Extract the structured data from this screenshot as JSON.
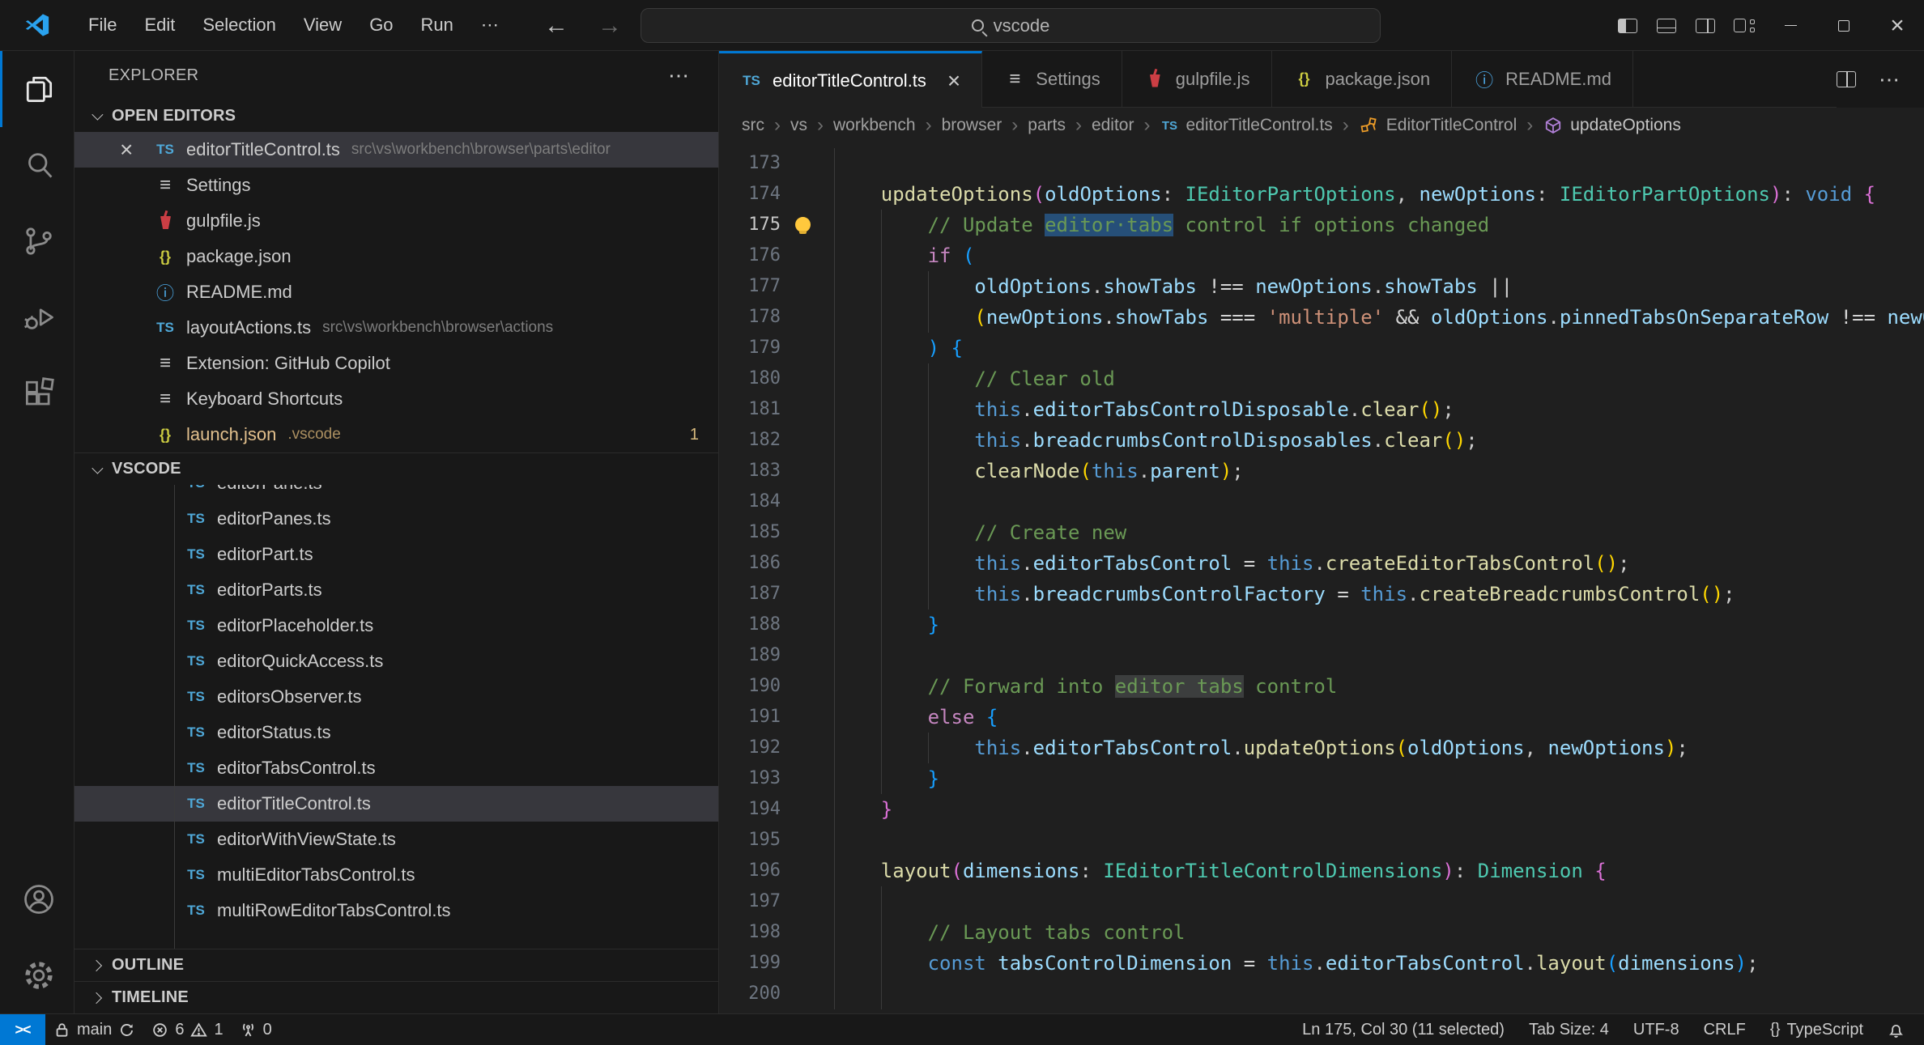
{
  "titlebar": {
    "menus": [
      "File",
      "Edit",
      "Selection",
      "View",
      "Go",
      "Run"
    ],
    "more_label": "⋯",
    "back_arrow": "←",
    "forward_arrow": "→",
    "search": {
      "value": "vscode"
    }
  },
  "activity_bar": {
    "items": [
      {
        "name": "explorer",
        "active": true
      },
      {
        "name": "search",
        "active": false
      },
      {
        "name": "source-control",
        "active": false
      },
      {
        "name": "run-debug",
        "active": false
      },
      {
        "name": "extensions",
        "active": false
      }
    ],
    "bottom": [
      {
        "name": "accounts"
      },
      {
        "name": "settings-gear"
      }
    ]
  },
  "sidebar": {
    "title": "EXPLORER",
    "title_more": "⋯",
    "open_editors": {
      "label": "OPEN EDITORS",
      "items": [
        {
          "icon": "ts",
          "name": "editorTitleControl.ts",
          "path": "src\\vs\\workbench\\browser\\parts\\editor",
          "selected": true
        },
        {
          "icon": "list",
          "name": "Settings"
        },
        {
          "icon": "gulp",
          "name": "gulpfile.js"
        },
        {
          "icon": "json",
          "name": "package.json"
        },
        {
          "icon": "info",
          "name": "README.md"
        },
        {
          "icon": "ts",
          "name": "layoutActions.ts",
          "path": "src\\vs\\workbench\\browser\\actions"
        },
        {
          "icon": "list",
          "name": "Extension: GitHub Copilot"
        },
        {
          "icon": "list",
          "name": "Keyboard Shortcuts"
        },
        {
          "icon": "json",
          "name": "launch.json",
          "path": ".vscode",
          "modified": true,
          "badge": "1"
        }
      ]
    },
    "project": {
      "label": "VSCODE",
      "partial_item": {
        "icon": "ts",
        "name": "editorPane.ts"
      },
      "items": [
        {
          "icon": "ts",
          "name": "editorPanes.ts"
        },
        {
          "icon": "ts",
          "name": "editorPart.ts"
        },
        {
          "icon": "ts",
          "name": "editorParts.ts"
        },
        {
          "icon": "ts",
          "name": "editorPlaceholder.ts"
        },
        {
          "icon": "ts",
          "name": "editorQuickAccess.ts"
        },
        {
          "icon": "ts",
          "name": "editorsObserver.ts"
        },
        {
          "icon": "ts",
          "name": "editorStatus.ts"
        },
        {
          "icon": "ts",
          "name": "editorTabsControl.ts"
        },
        {
          "icon": "ts",
          "name": "editorTitleControl.ts",
          "selected": true
        },
        {
          "icon": "ts",
          "name": "editorWithViewState.ts"
        },
        {
          "icon": "ts",
          "name": "multiEditorTabsControl.ts"
        },
        {
          "icon": "ts",
          "name": "multiRowEditorTabsControl.ts"
        }
      ]
    },
    "sections": [
      {
        "label": "OUTLINE"
      },
      {
        "label": "TIMELINE"
      }
    ]
  },
  "tabs": {
    "items": [
      {
        "icon": "ts",
        "label": "editorTitleControl.ts",
        "active": true,
        "close": "×"
      },
      {
        "icon": "list",
        "label": "Settings"
      },
      {
        "icon": "gulp",
        "label": "gulpfile.js"
      },
      {
        "icon": "json",
        "label": "package.json"
      },
      {
        "icon": "info",
        "label": "README.md"
      }
    ],
    "actions_more": "⋯"
  },
  "breadcrumbs": [
    {
      "label": "src"
    },
    {
      "label": "vs"
    },
    {
      "label": "workbench"
    },
    {
      "label": "browser"
    },
    {
      "label": "parts"
    },
    {
      "label": "editor"
    },
    {
      "label": "editorTitleControl.ts",
      "icon": "ts"
    },
    {
      "label": "EditorTitleControl",
      "icon": "class"
    },
    {
      "label": "updateOptions",
      "icon": "method"
    }
  ],
  "breadcrumb_sep": "›",
  "icons": {
    "ts": "TS",
    "json": "{}",
    "info": "ⓘ",
    "list": "≡",
    "close": "×"
  },
  "code": {
    "bulb_line": 175,
    "lines": [
      {
        "n": 173,
        "i": 1,
        "t": []
      },
      {
        "n": 174,
        "i": 1,
        "t": [
          [
            "fn",
            "updateOptions"
          ],
          [
            "b2",
            "("
          ],
          [
            "var",
            "oldOptions"
          ],
          [
            "txt",
            ": "
          ],
          [
            "type",
            "IEditorPartOptions"
          ],
          [
            "txt",
            ", "
          ],
          [
            "var",
            "newOptions"
          ],
          [
            "txt",
            ": "
          ],
          [
            "type",
            "IEditorPartOptions"
          ],
          [
            "b2",
            ")"
          ],
          [
            "txt",
            ": "
          ],
          [
            "kw",
            "void"
          ],
          [
            "txt",
            " "
          ],
          [
            "b2",
            "{"
          ]
        ]
      },
      {
        "n": 175,
        "i": 2,
        "t": [
          [
            "com",
            "// Update "
          ],
          [
            "com sel",
            "editor·tabs"
          ],
          [
            "com",
            " control if options changed"
          ]
        ]
      },
      {
        "n": 176,
        "i": 2,
        "t": [
          [
            "ctl",
            "if"
          ],
          [
            "txt",
            " "
          ],
          [
            "b3",
            "("
          ]
        ]
      },
      {
        "n": 177,
        "i": 3,
        "t": [
          [
            "var",
            "oldOptions"
          ],
          [
            "txt",
            "."
          ],
          [
            "var",
            "showTabs"
          ],
          [
            "op",
            " !== "
          ],
          [
            "var",
            "newOptions"
          ],
          [
            "txt",
            "."
          ],
          [
            "var",
            "showTabs"
          ],
          [
            "op",
            " ||"
          ]
        ]
      },
      {
        "n": 178,
        "i": 3,
        "t": [
          [
            "b1",
            "("
          ],
          [
            "var",
            "newOptions"
          ],
          [
            "txt",
            "."
          ],
          [
            "var",
            "showTabs"
          ],
          [
            "op",
            " === "
          ],
          [
            "str",
            "'multiple'"
          ],
          [
            "op",
            " && "
          ],
          [
            "var",
            "oldOptions"
          ],
          [
            "txt",
            "."
          ],
          [
            "var",
            "pinnedTabsOnSeparateRow"
          ],
          [
            "op",
            " !== "
          ],
          [
            "var",
            "newOptions"
          ],
          [
            "txt",
            "."
          ],
          [
            "var",
            "pinnedTabsOnSeparateRow"
          ],
          [
            "b1",
            ")"
          ]
        ]
      },
      {
        "n": 179,
        "i": 2,
        "t": [
          [
            "b3",
            ")"
          ],
          [
            "txt",
            " "
          ],
          [
            "b3",
            "{"
          ]
        ]
      },
      {
        "n": 180,
        "i": 3,
        "t": [
          [
            "com",
            "// Clear old"
          ]
        ]
      },
      {
        "n": 181,
        "i": 3,
        "t": [
          [
            "kw",
            "this"
          ],
          [
            "txt",
            "."
          ],
          [
            "var",
            "editorTabsControlDisposable"
          ],
          [
            "txt",
            "."
          ],
          [
            "fn",
            "clear"
          ],
          [
            "b1",
            "()"
          ],
          [
            "txt",
            ";"
          ]
        ]
      },
      {
        "n": 182,
        "i": 3,
        "t": [
          [
            "kw",
            "this"
          ],
          [
            "txt",
            "."
          ],
          [
            "var",
            "breadcrumbsControlDisposables"
          ],
          [
            "txt",
            "."
          ],
          [
            "fn",
            "clear"
          ],
          [
            "b1",
            "()"
          ],
          [
            "txt",
            ";"
          ]
        ]
      },
      {
        "n": 183,
        "i": 3,
        "t": [
          [
            "fn",
            "clearNode"
          ],
          [
            "b1",
            "("
          ],
          [
            "kw",
            "this"
          ],
          [
            "txt",
            "."
          ],
          [
            "var",
            "parent"
          ],
          [
            "b1",
            ")"
          ],
          [
            "txt",
            ";"
          ]
        ]
      },
      {
        "n": 184,
        "i": 3,
        "t": []
      },
      {
        "n": 185,
        "i": 3,
        "t": [
          [
            "com",
            "// Create new"
          ]
        ]
      },
      {
        "n": 186,
        "i": 3,
        "t": [
          [
            "kw",
            "this"
          ],
          [
            "txt",
            "."
          ],
          [
            "var",
            "editorTabsControl"
          ],
          [
            "op",
            " = "
          ],
          [
            "kw",
            "this"
          ],
          [
            "txt",
            "."
          ],
          [
            "fn",
            "createEditorTabsControl"
          ],
          [
            "b1",
            "()"
          ],
          [
            "txt",
            ";"
          ]
        ]
      },
      {
        "n": 187,
        "i": 3,
        "t": [
          [
            "kw",
            "this"
          ],
          [
            "txt",
            "."
          ],
          [
            "var",
            "breadcrumbsControlFactory"
          ],
          [
            "op",
            " = "
          ],
          [
            "kw",
            "this"
          ],
          [
            "txt",
            "."
          ],
          [
            "fn",
            "createBreadcrumbsControl"
          ],
          [
            "b1",
            "()"
          ],
          [
            "txt",
            ";"
          ]
        ]
      },
      {
        "n": 188,
        "i": 2,
        "t": [
          [
            "b3",
            "}"
          ]
        ]
      },
      {
        "n": 189,
        "i": 2,
        "t": []
      },
      {
        "n": 190,
        "i": 2,
        "t": [
          [
            "com",
            "// Forward into "
          ],
          [
            "com occ",
            "editor tabs"
          ],
          [
            "com",
            " control"
          ]
        ]
      },
      {
        "n": 191,
        "i": 2,
        "t": [
          [
            "ctl",
            "else"
          ],
          [
            "txt",
            " "
          ],
          [
            "b3",
            "{"
          ]
        ]
      },
      {
        "n": 192,
        "i": 3,
        "t": [
          [
            "kw",
            "this"
          ],
          [
            "txt",
            "."
          ],
          [
            "var",
            "editorTabsControl"
          ],
          [
            "txt",
            "."
          ],
          [
            "fn",
            "updateOptions"
          ],
          [
            "b1",
            "("
          ],
          [
            "var",
            "oldOptions"
          ],
          [
            "txt",
            ", "
          ],
          [
            "var",
            "newOptions"
          ],
          [
            "b1",
            ")"
          ],
          [
            "txt",
            ";"
          ]
        ]
      },
      {
        "n": 193,
        "i": 2,
        "t": [
          [
            "b3",
            "}"
          ]
        ]
      },
      {
        "n": 194,
        "i": 1,
        "t": [
          [
            "b2",
            "}"
          ]
        ]
      },
      {
        "n": 195,
        "i": 1,
        "t": []
      },
      {
        "n": 196,
        "i": 1,
        "t": [
          [
            "fn",
            "layout"
          ],
          [
            "b2",
            "("
          ],
          [
            "var",
            "dimensions"
          ],
          [
            "txt",
            ": "
          ],
          [
            "type",
            "IEditorTitleControlDimensions"
          ],
          [
            "b2",
            ")"
          ],
          [
            "txt",
            ": "
          ],
          [
            "type",
            "Dimension"
          ],
          [
            "txt",
            " "
          ],
          [
            "b2",
            "{"
          ]
        ]
      },
      {
        "n": 197,
        "i": 2,
        "t": []
      },
      {
        "n": 198,
        "i": 2,
        "t": [
          [
            "com",
            "// Layout tabs control"
          ]
        ]
      },
      {
        "n": 199,
        "i": 2,
        "t": [
          [
            "kw",
            "const"
          ],
          [
            "txt",
            " "
          ],
          [
            "var",
            "tabsControlDimension"
          ],
          [
            "op",
            " = "
          ],
          [
            "kw",
            "this"
          ],
          [
            "txt",
            "."
          ],
          [
            "var",
            "editorTabsControl"
          ],
          [
            "txt",
            "."
          ],
          [
            "fn",
            "layout"
          ],
          [
            "b3",
            "("
          ],
          [
            "var",
            "dimensions"
          ],
          [
            "b3",
            ")"
          ],
          [
            "txt",
            ";"
          ]
        ]
      },
      {
        "n": 200,
        "i": 2,
        "t": []
      }
    ]
  },
  "status": {
    "remote_glyph": "><",
    "branch": "main",
    "errors": "6",
    "warnings": "1",
    "ports": "0",
    "position": "Ln 175, Col 30 (11 selected)",
    "tab_size": "Tab Size: 4",
    "encoding": "UTF-8",
    "eol": "CRLF",
    "braces": "{}",
    "language": "TypeScript"
  }
}
